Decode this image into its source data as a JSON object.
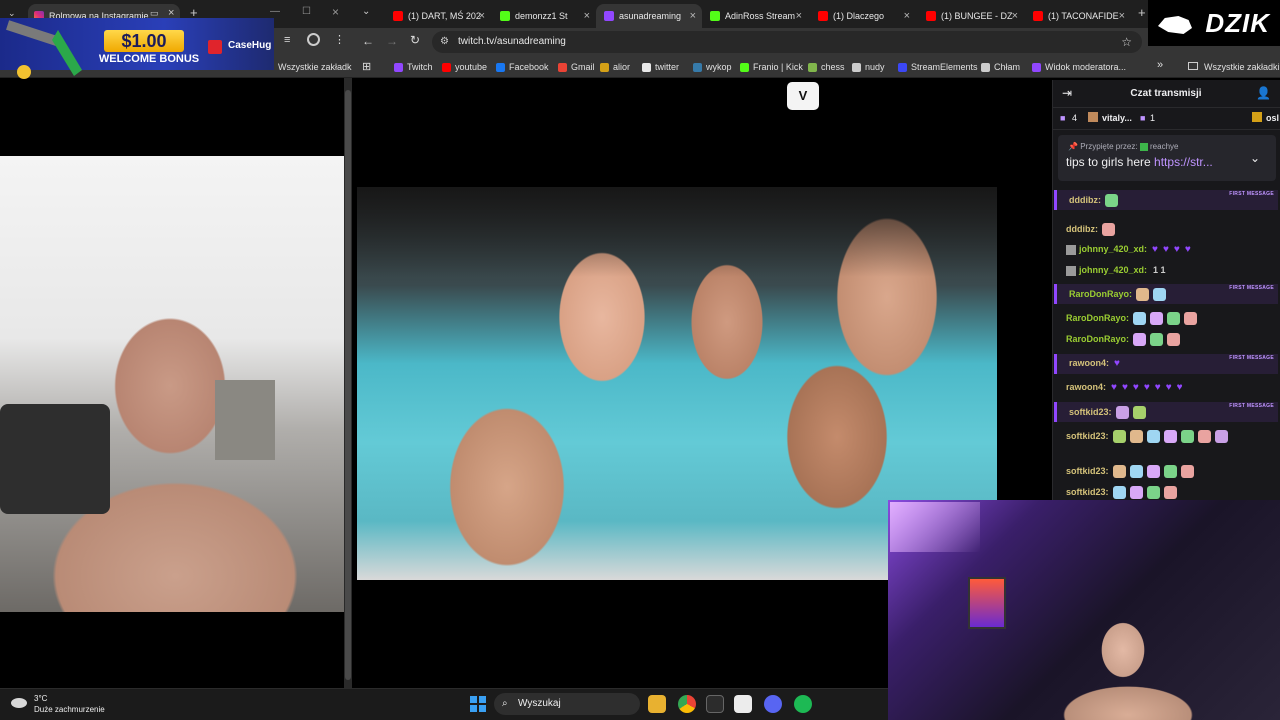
{
  "left_browser": {
    "tab_title": "Rolmowa na Instagramie",
    "bookmarks_all": "Wszystkie zakładki"
  },
  "ad": {
    "amount": "$1.00",
    "bonus": "WELCOME BONUS",
    "brand": "CaseHug"
  },
  "main_browser": {
    "tabs": [
      {
        "label": "(1) DART, MŚ 202",
        "icon": "youtube-icon",
        "color": "#ff0000"
      },
      {
        "label": "demonzz1 St",
        "icon": "kick-icon",
        "color": "#53fc18"
      },
      {
        "label": "asunadreaming",
        "icon": "twitch-icon",
        "color": "#9147ff"
      },
      {
        "label": "AdinRoss Stream",
        "icon": "kick-icon",
        "color": "#53fc18"
      },
      {
        "label": "(1) Dlaczego",
        "icon": "youtube-icon",
        "color": "#ff0000"
      },
      {
        "label": "(1) BUNGEE - DZ",
        "icon": "youtube-icon",
        "color": "#ff0000"
      },
      {
        "label": "(1) TACONAFIDE",
        "icon": "youtube-icon",
        "color": "#ff0000"
      }
    ],
    "url": "twitch.tv/asunadreaming",
    "bookmarks": [
      {
        "label": "Twitch",
        "icon": "twitch-icon",
        "color": "#9147ff"
      },
      {
        "label": "youtube",
        "icon": "youtube-icon",
        "color": "#ff0000"
      },
      {
        "label": "Facebook",
        "icon": "facebook-icon",
        "color": "#1877f2"
      },
      {
        "label": "Gmail",
        "icon": "gmail-icon",
        "color": "#ea4335"
      },
      {
        "label": "alior",
        "icon": "alior-icon",
        "color": "#d4a017"
      },
      {
        "label": "twitter",
        "icon": "x-icon",
        "color": "#e8e8e8"
      },
      {
        "label": "wykop",
        "icon": "wykop-icon",
        "color": "#367aa9"
      },
      {
        "label": "Franio | Kick",
        "icon": "kick-icon",
        "color": "#53fc18"
      },
      {
        "label": "chess",
        "icon": "chess-icon",
        "color": "#81b64c"
      },
      {
        "label": "nudy",
        "icon": "folder-icon",
        "color": "#cccccc"
      },
      {
        "label": "StreamElements",
        "icon": "streamelements-icon",
        "color": "#3b47f5"
      },
      {
        "label": "Chłam",
        "icon": "globe-icon",
        "color": "#cccccc"
      },
      {
        "label": "Widok moderatora...",
        "icon": "twitch-icon",
        "color": "#9147ff"
      }
    ],
    "bookmarks_all": "Wszystkie zakładki"
  },
  "player": {
    "logo_text": "V"
  },
  "chat": {
    "title": "Czat transmisji",
    "leaderboard": [
      {
        "rank": "4",
        "name": "",
        "count": ""
      },
      {
        "rank": "",
        "name": "vitaly...",
        "count": "1"
      },
      {
        "rank": "",
        "name": "osl",
        "count": ""
      }
    ],
    "pinned_by_label": "Przypięte przez:",
    "pinned_by_user": "reachye",
    "pinned_text": "tips to girls here",
    "pinned_link": "https://str...",
    "first_message_tag": "FIRST MESSAGE",
    "messages": [
      {
        "user": "dddibz:",
        "first": true,
        "content": "tree-emote"
      },
      {
        "user": "dddibz:",
        "first": false,
        "content": "santa-emote"
      },
      {
        "user": "johnny_420_xd:",
        "first": false,
        "content": "hearts"
      },
      {
        "user": "johnny_420_xd:",
        "first": false,
        "content": "ranks",
        "text": "1   1"
      },
      {
        "user": "RaroDonRayo:",
        "first": true,
        "content": "emotes"
      },
      {
        "user": "RaroDonRayo:",
        "first": false,
        "content": "emotes"
      },
      {
        "user": "RaroDonRayo:",
        "first": false,
        "content": "emotes"
      },
      {
        "user": "rawoon4:",
        "first": true,
        "content": "heart"
      },
      {
        "user": "rawoon4:",
        "first": false,
        "content": "hearts"
      },
      {
        "user": "softkid23:",
        "first": true,
        "content": "emotes"
      },
      {
        "user": "softkid23:",
        "first": false,
        "content": "emotes"
      },
      {
        "user": "softkid23:",
        "first": false,
        "content": "emotes"
      },
      {
        "user": "softkid23:",
        "first": false,
        "content": "emotes"
      }
    ]
  },
  "overlay": {
    "brand": "DZIK"
  },
  "taskbar": {
    "temperature": "3°C",
    "weather": "Duże zachmurzenie",
    "search_placeholder": "Wyszukaj"
  }
}
